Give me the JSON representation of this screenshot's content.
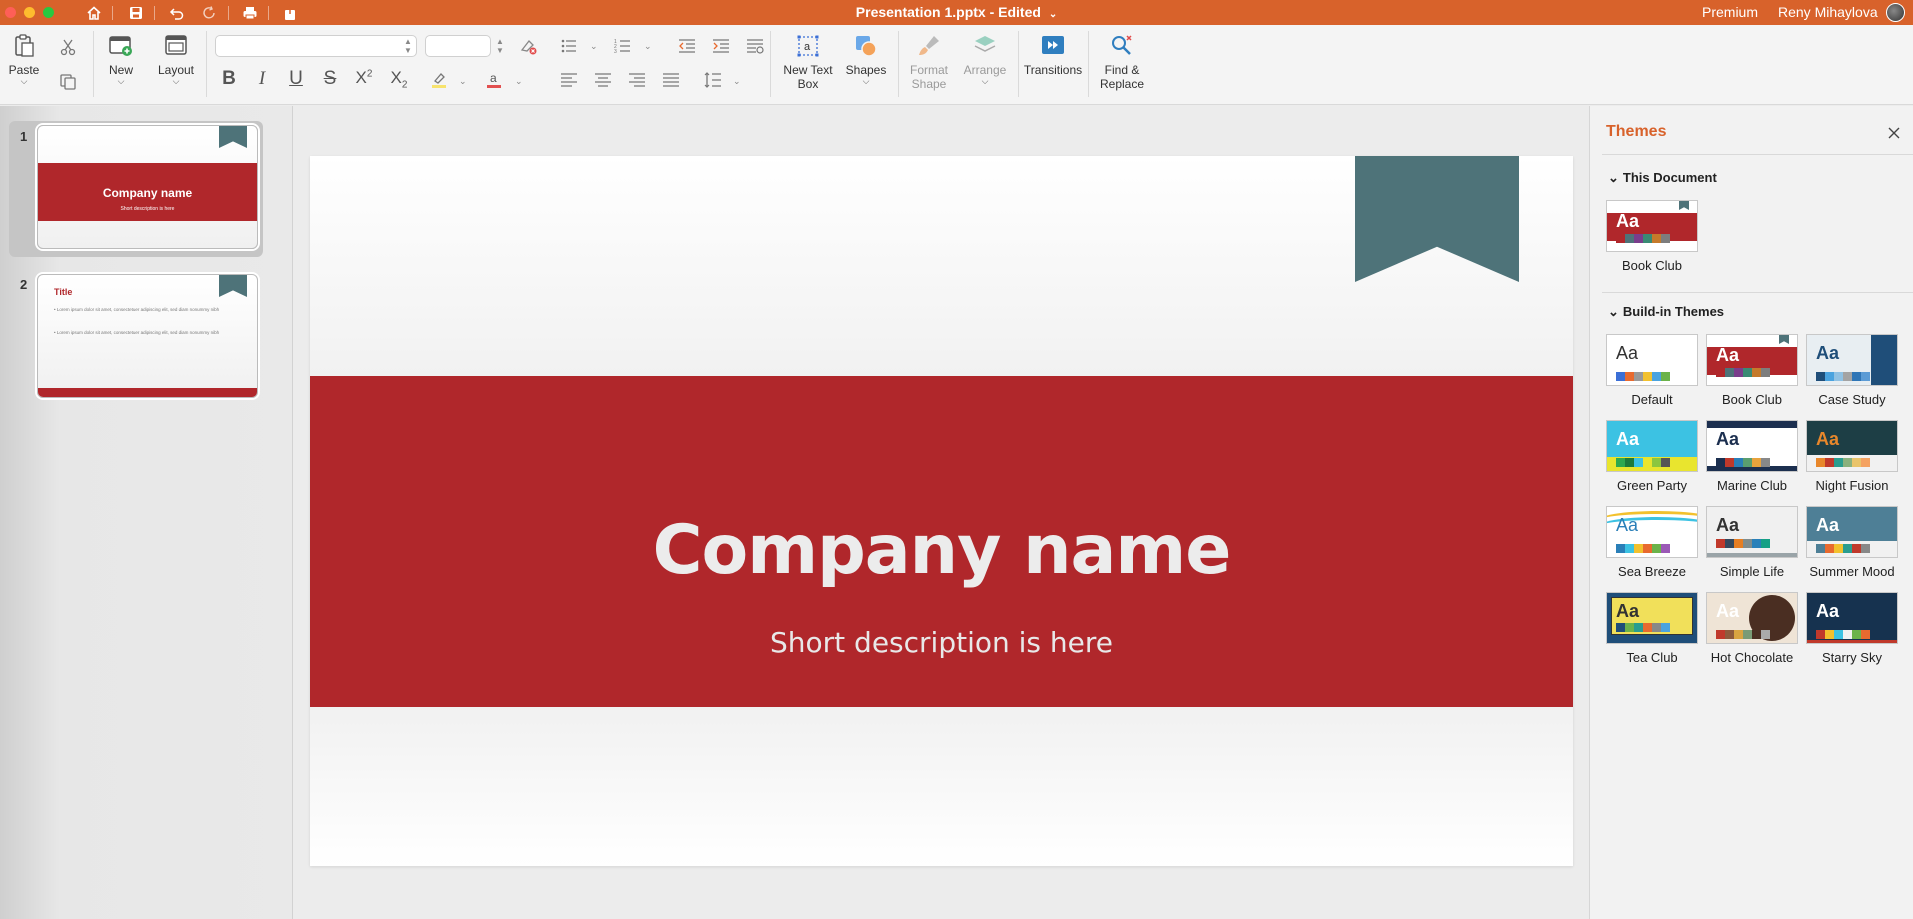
{
  "titlebar": {
    "doc_title": "Presentation 1.pptx - Edited",
    "premium": "Premium",
    "user_name": "Reny Mihaylova"
  },
  "ribbon": {
    "paste": "Paste",
    "new": "New",
    "layout": "Layout",
    "new_text_box_1": "New Text",
    "new_text_box_2": "Box",
    "shapes": "Shapes",
    "format_shape_1": "Format",
    "format_shape_2": "Shape",
    "arrange": "Arrange",
    "transitions": "Transitions",
    "find_replace_1": "Find &",
    "find_replace_2": "Replace",
    "bold": "B",
    "italic": "I",
    "underline": "U",
    "strike": "S"
  },
  "slides": [
    {
      "number": "1",
      "title": "Company name",
      "subtitle": "Short description is here"
    },
    {
      "number": "2",
      "title": "Title",
      "bullet1": "Lorem ipsum dolor sit amet, consectetuer adipiscing elit, sed diam nonummy nibh",
      "bullet2": "Lorem ipsum dolor sit amet, consectetuer adipiscing elit, sed diam nonummy nibh"
    }
  ],
  "main_slide": {
    "title": "Company name",
    "subtitle": "Short description is here"
  },
  "themes_panel": {
    "title": "Themes",
    "this_document": "This Document",
    "build_in": "Build-in Themes",
    "current": {
      "name": "Book Club"
    },
    "list": [
      {
        "name": "Default"
      },
      {
        "name": "Book Club"
      },
      {
        "name": "Case Study"
      },
      {
        "name": "Green Party"
      },
      {
        "name": "Marine Club"
      },
      {
        "name": "Night Fusion"
      },
      {
        "name": "Sea Breeze"
      },
      {
        "name": "Simple Life"
      },
      {
        "name": "Summer Mood"
      },
      {
        "name": "Tea Club"
      },
      {
        "name": "Hot Chocolate"
      },
      {
        "name": "Starry Sky"
      }
    ],
    "aa": "Aa"
  },
  "colors": {
    "accent": "#d8622b",
    "brand_red": "#b0272b",
    "bookmark": "#4e7379"
  }
}
